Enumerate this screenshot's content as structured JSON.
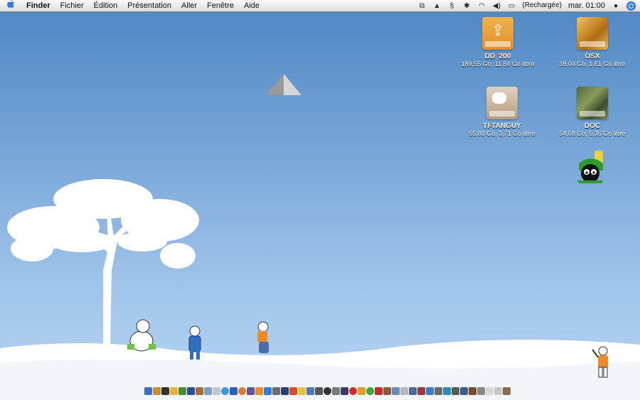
{
  "menubar": {
    "apple": "",
    "items": [
      "Finder",
      "Fichier",
      "Édition",
      "Présentation",
      "Aller",
      "Fenêtre",
      "Aide"
    ],
    "battery_status": "(Rechargée)",
    "clock": "mar. 01:00"
  },
  "desktop": {
    "drives": [
      {
        "name": "DD_200",
        "info": "189,55 Go, 11,84 Go libre",
        "icon": "usb-drive-icon"
      },
      {
        "name": "OSX",
        "info": "38,04 Go, 1,61 Go libre",
        "icon": "internal-drive-icon"
      },
      {
        "name": "TI-TANGUY",
        "info": "55,88 Go, 3,71 Go libre",
        "icon": "external-drive-icon"
      },
      {
        "name": "DOC",
        "info": "54,68 Go, 5,36 Go libre",
        "icon": "camouflage-drive-icon"
      }
    ]
  },
  "colors": {
    "sky_top": "#4f86c2",
    "sky_bottom": "#b9d6f2",
    "snow": "#ffffff",
    "menubar": "#e8e8e8"
  }
}
